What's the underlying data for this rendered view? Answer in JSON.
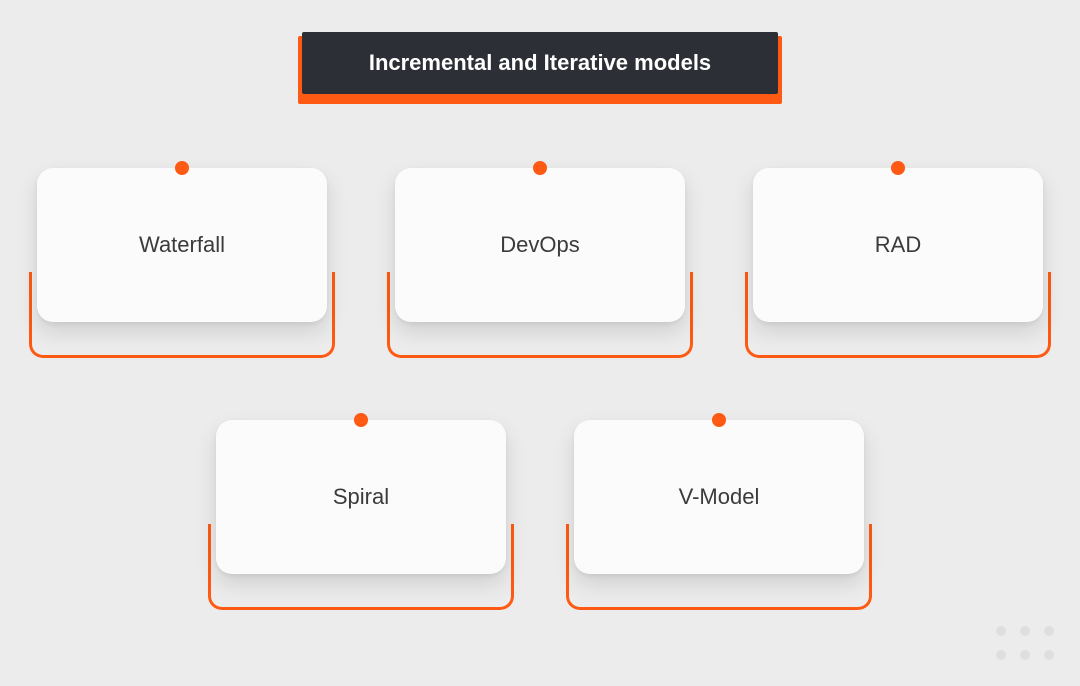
{
  "title": "Incremental and Iterative models",
  "row1": [
    {
      "label": "Waterfall"
    },
    {
      "label": "DevOps"
    },
    {
      "label": "RAD"
    }
  ],
  "row2": [
    {
      "label": "Spiral"
    },
    {
      "label": "V-Model"
    }
  ],
  "colors": {
    "accent": "#ff5a13",
    "titleBg": "#2c3036",
    "pageBg": "#ececec",
    "cardBg": "#fbfbfb"
  }
}
